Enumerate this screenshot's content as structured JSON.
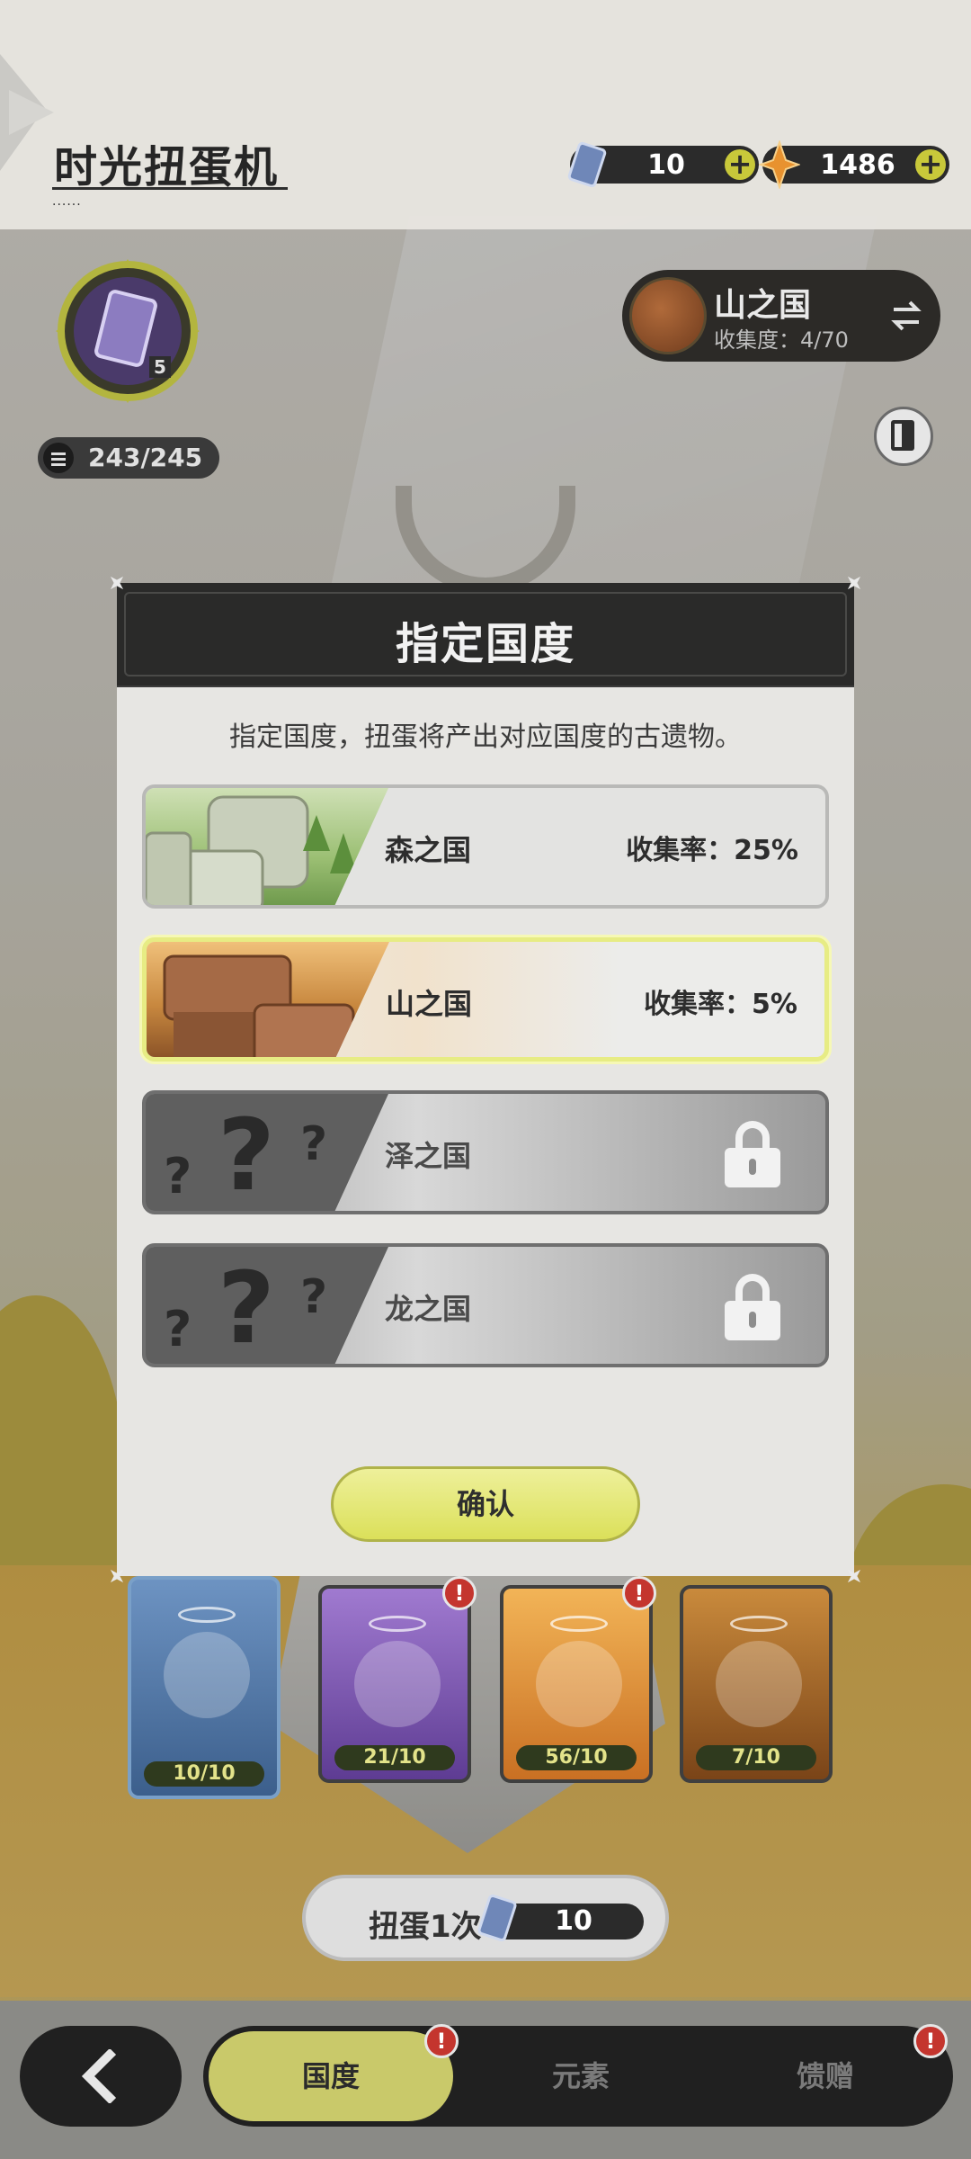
{
  "header": {
    "title": "时光扭蛋机",
    "title_dots": "......",
    "currencies": [
      {
        "icon": "blue-crystal-ticket-icon",
        "value": "10"
      },
      {
        "icon": "orange-star-gem-icon",
        "value": "1486"
      }
    ]
  },
  "left_panel": {
    "medal_level": "5",
    "counter": "243/245"
  },
  "region_pill": {
    "name": "山之国",
    "progress": "收集度：4/70"
  },
  "modal": {
    "title": "指定国度",
    "description": "指定国度，扭蛋将产出对应国度的古遗物。",
    "regions": [
      {
        "name": "森之国",
        "rate": "收集率：25%",
        "state": "available"
      },
      {
        "name": "山之国",
        "rate": "收集率：5%",
        "state": "selected"
      },
      {
        "name": "泽之国",
        "rate": "",
        "state": "locked"
      },
      {
        "name": "龙之国",
        "rate": "",
        "state": "locked"
      }
    ],
    "confirm_label": "确认"
  },
  "characters": [
    {
      "count": "10/10",
      "color": "#5a86b5",
      "badge": false
    },
    {
      "count": "21/10",
      "color": "#8b63b8",
      "badge": true
    },
    {
      "count": "56/10",
      "color": "#e79a3a",
      "badge": true
    },
    {
      "count": "7/10",
      "color": "#b86a2a",
      "badge": false
    }
  ],
  "spin": {
    "label": "扭蛋1次",
    "cost": "10"
  },
  "bottom_nav": {
    "tabs": [
      {
        "label": "国度",
        "active": true,
        "badge": true
      },
      {
        "label": "元素",
        "active": false,
        "badge": false
      },
      {
        "label": "馈赠",
        "active": false,
        "badge": true
      }
    ]
  },
  "colors": {
    "accent": "#dbe05a",
    "badge": "#c4352e",
    "dark": "#2a2a29"
  }
}
